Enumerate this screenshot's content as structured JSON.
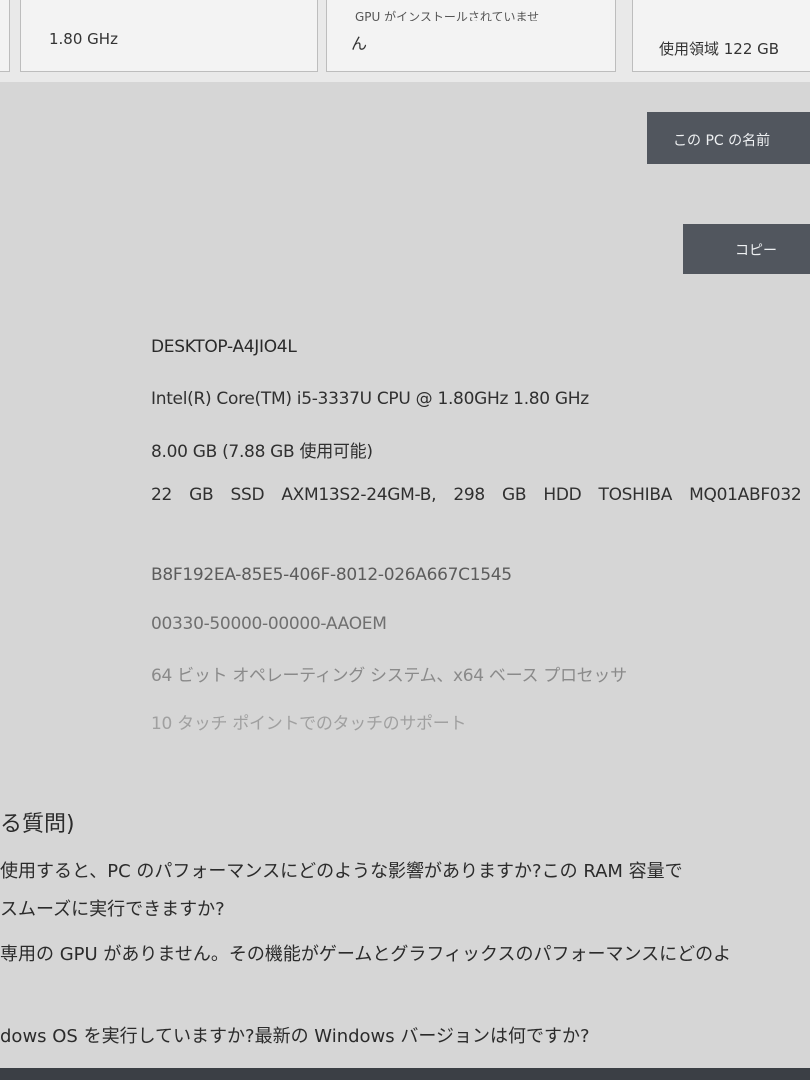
{
  "cards": {
    "processor_speed": "1.80 GHz",
    "gpu_note_line1": "GPU がインストールされていませ",
    "gpu_note_line2": "ん",
    "storage_used": "使用領域 122 GB"
  },
  "buttons": {
    "rename_pc": "この PC の名前",
    "copy": "コピー"
  },
  "specs": {
    "device_name": "DESKTOP-A4JIO4L",
    "processor": "Intel(R) Core(TM) i5-3337U CPU @ 1.80GHz   1.80 GHz",
    "ram": "8.00 GB (7.88 GB 使用可能)",
    "storage": "22 GB SSD AXM13S2-24GM-B, 298 GB HDD TOSHIBA MQ01ABF032",
    "device_id": "B8F192EA-85E5-406F-8012-026A667C1545",
    "product_id": "00330-50000-00000-AAOEM",
    "system_type": "64 ビット オペレーティング システム、x64 ベース プロセッサ",
    "pen_touch": "10 タッチ ポイントでのタッチのサポート"
  },
  "faq": {
    "heading": "る質問)",
    "q1_line1": "使用すると、PC のパフォーマンスにどのような影響がありますか?この RAM 容量で",
    "q1_line2": "スムーズに実行できますか?",
    "q2": "専用の GPU がありません。その機能がゲームとグラフィックスのパフォーマンスにどのよ",
    "q3": "dows OS を実行していますか?最新の Windows バージョンは何ですか?"
  }
}
